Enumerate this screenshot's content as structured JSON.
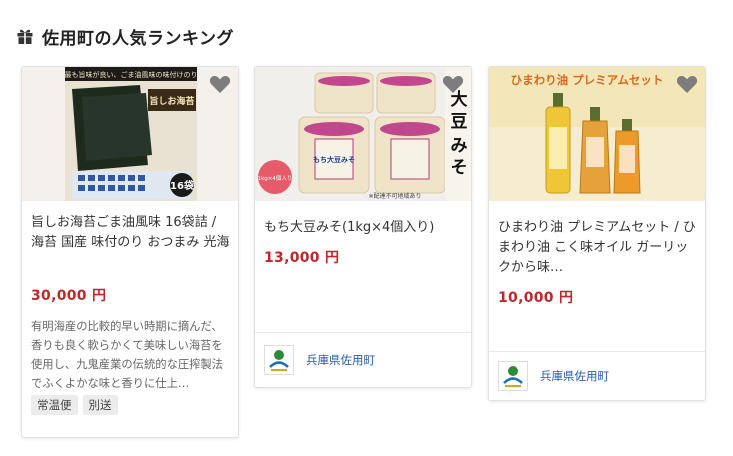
{
  "heading": {
    "title": "佐用町の人気ランキング",
    "icon": "gift-icon"
  },
  "products": [
    {
      "name": "旨しお海苔ごま油風味 16袋詰 / 海苔 国産 味付のり おつまみ 光海",
      "price": "30,000 円",
      "description": "有明海産の比較的早い時期に摘んだ、香りも良く軟らかくて美味しい海苔を使用し、九鬼産業の伝統的な圧搾製法でふくよかな味と香りに仕上…",
      "tags": [
        "常温便",
        "別送"
      ],
      "image_text": {
        "banner": "最も旨味が良い、ごま油風味の味付けのり",
        "title": "旨しお海苔",
        "count": "16袋"
      }
    },
    {
      "name": "もち大豆みそ(1kg×4個入り)",
      "price": "13,000 円",
      "municipality": "兵庫県佐用町",
      "image_text": {
        "title": "もち大豆みそ",
        "badge": "1kg×4個入り",
        "note": "※配達不可地域あり",
        "label": "もち大豆みそ"
      }
    },
    {
      "name": "ひまわり油 プレミアムセット / ひまわり油 こく味オイル ガーリックから味…",
      "price": "10,000 円",
      "municipality": "兵庫県佐用町",
      "image_text": {
        "title": "ひまわり油 プレミアムセット"
      }
    }
  ],
  "colors": {
    "price": "#c0262a",
    "municipality_link": "#2a5aa8",
    "tag_bg": "#ececec"
  }
}
